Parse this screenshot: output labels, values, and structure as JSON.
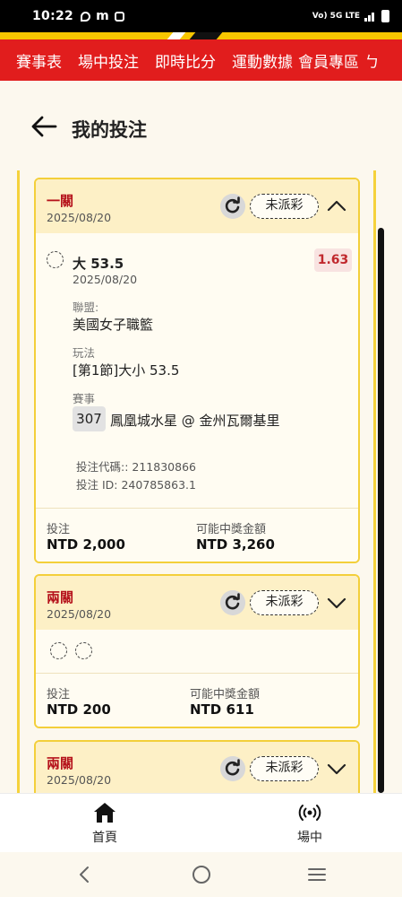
{
  "status_bar": {
    "time": "10:22",
    "network": "Vo) 5G LTE"
  },
  "top_nav": {
    "items": [
      "賽事表",
      "場中投注",
      "即時比分",
      "運動數據",
      "會員專區",
      "ㄅ"
    ]
  },
  "header": {
    "title": "我的投注"
  },
  "bets": [
    {
      "type": "一關",
      "date": "2025/08/20",
      "status": "未派彩",
      "expanded": true,
      "selection": {
        "name": "大 53.5",
        "date": "2025/08/20",
        "odds": "1.63",
        "league_label": "聯盟:",
        "league": "美國女子職籃",
        "play_label": "玩法",
        "play": "[第1節]大小 53.5",
        "event_label": "賽事",
        "event_number": "307",
        "event_name": "鳳凰城水星 @ 金州瓦爾基里"
      },
      "bet_code": "投注代碼:: 211830866",
      "bet_id": "投注 ID: 240785863.1",
      "stake_label": "投注",
      "stake": "NTD 2,000",
      "payout_label": "可能中獎金額",
      "payout": "NTD 3,260"
    },
    {
      "type": "兩關",
      "date": "2025/08/20",
      "status": "未派彩",
      "expanded": false,
      "stake_label": "投注",
      "stake": "NTD 200",
      "payout_label": "可能中獎金額",
      "payout": "NTD 611"
    },
    {
      "type": "兩關",
      "date": "2025/08/20",
      "status": "未派彩",
      "expanded": false
    }
  ],
  "bottom_nav": {
    "home": "首頁",
    "live": "場中"
  },
  "colors": {
    "brand_red": "#e11d1d",
    "brand_yellow": "#f7c600",
    "odds_red": "#c0282d",
    "bet_type_red": "#b5121b"
  }
}
